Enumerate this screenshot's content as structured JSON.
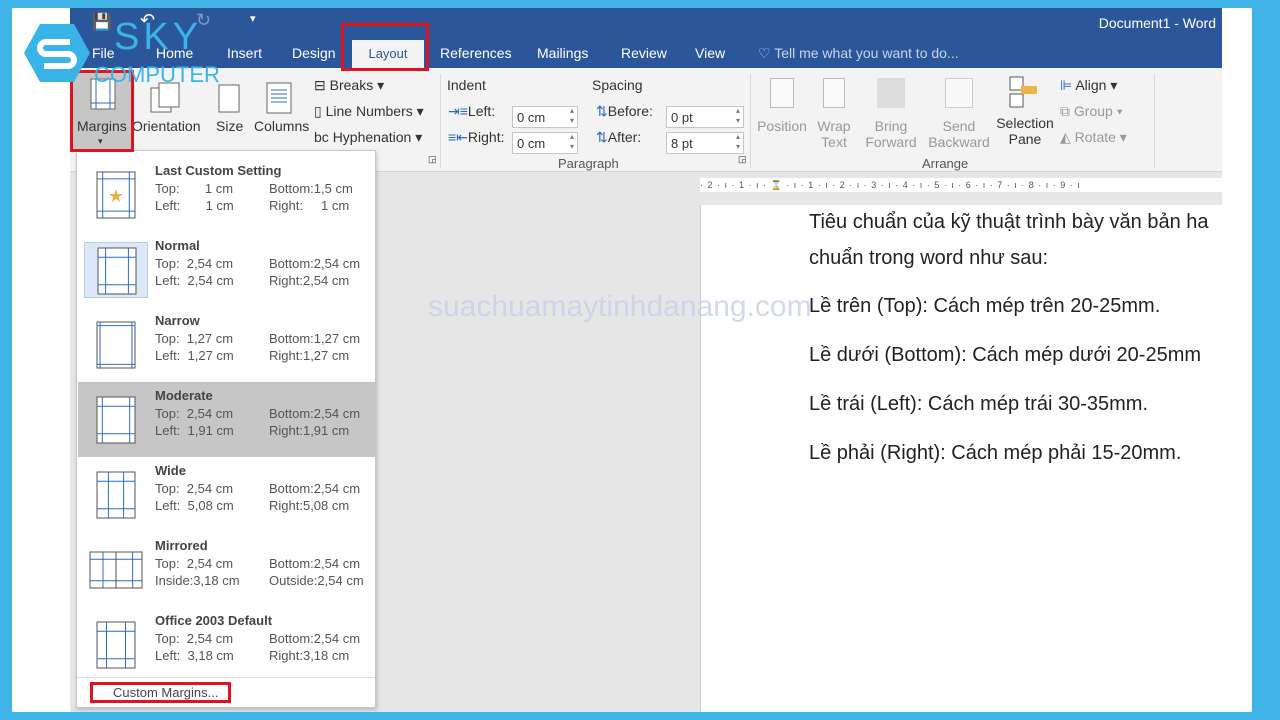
{
  "window": {
    "title": "Document1 - Word"
  },
  "tabs": [
    "File",
    "Home",
    "Insert",
    "Design",
    "Layout",
    "References",
    "Mailings",
    "Review",
    "View"
  ],
  "active_tab": "Layout",
  "tell_me": "Tell me what you want to do...",
  "page_setup": {
    "margins": "Margins",
    "orientation": "Orientation",
    "size": "Size",
    "columns": "Columns",
    "breaks": "Breaks",
    "line_numbers": "Line Numbers",
    "hyphenation": "Hyphenation"
  },
  "paragraph": {
    "group": "Paragraph",
    "indent": "Indent",
    "spacing": "Spacing",
    "left_label": "Left:",
    "left_value": "0 cm",
    "right_label": "Right:",
    "right_value": "0 cm",
    "before_label": "Before:",
    "before_value": "0 pt",
    "after_label": "After:",
    "after_value": "8 pt"
  },
  "arrange": {
    "group": "Arrange",
    "position": "Position",
    "wrap1": "Wrap",
    "wrap2": "Text",
    "bring1": "Bring",
    "bring2": "Forward",
    "send1": "Send",
    "send2": "Backward",
    "sel1": "Selection",
    "sel2": "Pane",
    "align": "Align",
    "group_btn": "Group",
    "rotate": "Rotate"
  },
  "ruler": "· 2 · ı · 1 · ı · ⌛ · ı · 1 · ı · 2 · ı · 3 · ı · 4 · ı · 5 · ı · 6 · ı · 7 · ı · 8 · ı · 9 · ı",
  "margins_menu": {
    "items": [
      {
        "name": "Last Custom Setting",
        "r1a": "Top:       1 cm",
        "r1b": "Bottom:1,5 cm",
        "r2a": "Left:       1 cm",
        "r2b": "Right:     1 cm",
        "icon": "star-margin"
      },
      {
        "name": "Normal",
        "r1a": "Top:  2,54 cm",
        "r1b": "Bottom:2,54 cm",
        "r2a": "Left:  2,54 cm",
        "r2b": "Right:2,54 cm",
        "icon": "normal-margin"
      },
      {
        "name": "Narrow",
        "r1a": "Top:  1,27 cm",
        "r1b": "Bottom:1,27 cm",
        "r2a": "Left:  1,27 cm",
        "r2b": "Right:1,27 cm",
        "icon": "narrow-margin"
      },
      {
        "name": "Moderate",
        "r1a": "Top:  2,54 cm",
        "r1b": "Bottom:2,54 cm",
        "r2a": "Left:  1,91 cm",
        "r2b": "Right:1,91 cm",
        "icon": "moderate-margin"
      },
      {
        "name": "Wide",
        "r1a": "Top:  2,54 cm",
        "r1b": "Bottom:2,54 cm",
        "r2a": "Left:  5,08 cm",
        "r2b": "Right:5,08 cm",
        "icon": "wide-margin"
      },
      {
        "name": "Mirrored",
        "r1a": "Top:  2,54 cm",
        "r1b": "Bottom:2,54 cm",
        "r2a": "Inside:3,18 cm",
        "r2b": "Outside:2,54 cm",
        "icon": "mirrored-margin"
      },
      {
        "name": "Office 2003 Default",
        "r1a": "Top:  2,54 cm",
        "r1b": "Bottom:2,54 cm",
        "r2a": "Left:  3,18 cm",
        "r2b": "Right:3,18 cm",
        "icon": "office2003-margin"
      }
    ],
    "custom": "Custom Margins..."
  },
  "document": {
    "paragraphs": [
      "Tiêu chuẩn của kỹ thuật trình bày văn bản ha",
      "chuẩn trong word như sau:",
      "Lề trên (Top): Cách mép trên 20-25mm.",
      "Lề dưới (Bottom): Cách mép dưới 20-25mm",
      "Lề trái (Left): Cách mép trái 30-35mm.",
      "Lề phải (Right): Cách mép phải 15-20mm."
    ]
  },
  "watermark": "suachuamaytinhdanang.com",
  "logo": {
    "line1": "SKY",
    "line2": "COMPUTER"
  },
  "colors": {
    "titlebar": "#2b579a",
    "ribbon": "#f3f3f3",
    "highlight": "#e0141e",
    "border": "#41b4e8",
    "logo": "#3ab4e8"
  }
}
